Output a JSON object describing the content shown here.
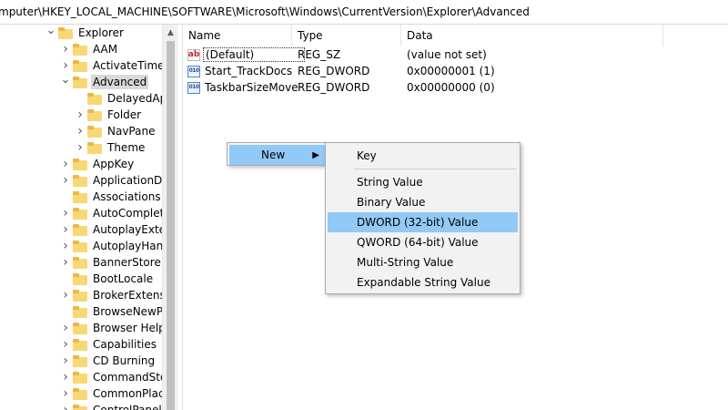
{
  "address": "mputer\\HKEY_LOCAL_MACHINE\\SOFTWARE\\Microsoft\\Windows\\CurrentVersion\\Explorer\\Advanced",
  "tree": {
    "items": [
      {
        "label": "Explorer",
        "state": "open"
      },
      {
        "label": "AAM",
        "state": "closed"
      },
      {
        "label": "ActivateTimecl",
        "state": "closed"
      },
      {
        "label": "Advanced",
        "state": "open",
        "selected": true
      },
      {
        "label": "DelayedAp",
        "state": "none"
      },
      {
        "label": "Folder",
        "state": "closed"
      },
      {
        "label": "NavPane",
        "state": "closed"
      },
      {
        "label": "Theme",
        "state": "closed"
      },
      {
        "label": "AppKey",
        "state": "closed"
      },
      {
        "label": "ApplicationDe",
        "state": "closed"
      },
      {
        "label": "Associations",
        "state": "none"
      },
      {
        "label": "AutoComplete",
        "state": "closed"
      },
      {
        "label": "AutoplayExten",
        "state": "closed"
      },
      {
        "label": "AutoplayHand",
        "state": "closed"
      },
      {
        "label": "BannerStore",
        "state": "closed"
      },
      {
        "label": "BootLocale",
        "state": "none"
      },
      {
        "label": "BrokerExtensic",
        "state": "closed"
      },
      {
        "label": "BrowseNewPr",
        "state": "none"
      },
      {
        "label": "Browser Helpe",
        "state": "closed"
      },
      {
        "label": "Capabilities",
        "state": "closed"
      },
      {
        "label": "CD Burning",
        "state": "closed"
      },
      {
        "label": "CommandSto",
        "state": "closed"
      },
      {
        "label": "CommonPlac",
        "state": "closed"
      },
      {
        "label": "ControlPanel",
        "state": "closed"
      }
    ]
  },
  "list": {
    "headers": {
      "name": "Name",
      "type": "Type",
      "data": "Data"
    },
    "rows": [
      {
        "icon": "string-value-icon",
        "glyph": "ab",
        "name": "(Default)",
        "type": "REG_SZ",
        "data": "(value not set)"
      },
      {
        "icon": "binary-value-icon",
        "glyph": "010",
        "name": "Start_TrackDocs",
        "type": "REG_DWORD",
        "data": "0x00000001 (1)"
      },
      {
        "icon": "binary-value-icon",
        "glyph": "010",
        "name": "TaskbarSizeMove",
        "type": "REG_DWORD",
        "data": "0x00000000 (0)"
      }
    ]
  },
  "context_menu": {
    "new_label": "New",
    "submenu": [
      {
        "label": "Key"
      },
      {
        "label": "String Value"
      },
      {
        "label": "Binary Value"
      },
      {
        "label": "DWORD (32-bit) Value",
        "highlighted": true
      },
      {
        "label": "QWORD (64-bit) Value"
      },
      {
        "label": "Multi-String Value"
      },
      {
        "label": "Expandable String Value"
      }
    ]
  },
  "colors": {
    "highlight": "#91c9f7",
    "tree_selected": "#d9d9d9",
    "folder": "#f8d775"
  }
}
